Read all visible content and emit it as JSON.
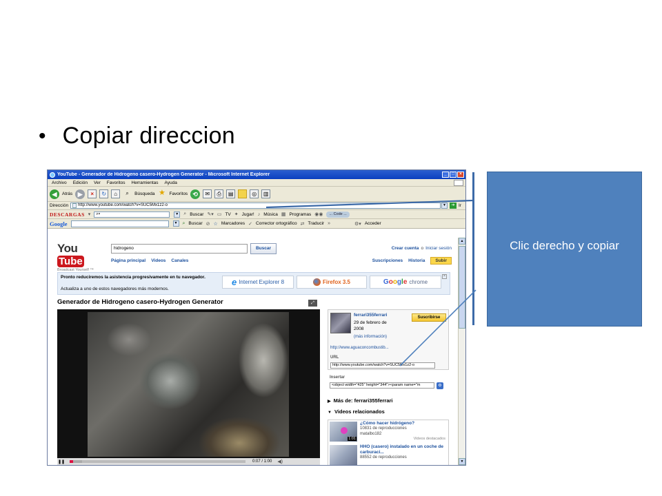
{
  "slide": {
    "bullet_text": "Copiar direccion",
    "callout_text": "Clic derecho y copiar",
    "callout_color": "#4f81bd"
  },
  "window": {
    "title": "YouTube - Generador de Hidrogeno casero-Hydrogen Generator - Microsoft Internet Explorer",
    "menu": [
      "Archivo",
      "Edición",
      "Ver",
      "Favoritos",
      "Herramientas",
      "Ayuda"
    ],
    "toolbar": {
      "back": "Atrás",
      "search": "Búsqueda",
      "favorites": "Favoritos"
    },
    "address_label": "Dirección",
    "address_value": "http://www.youtube.com/watch?v=SUC5Mx1z2-o",
    "go_label": "Ir",
    "descargas_label": "DESCARGAS",
    "descargas_items": {
      "buscar": "Buscar",
      "tv": "TV",
      "jugar": "Jugar!",
      "musica": "Música",
      "programas": "Programas",
      "code": "... Code ..."
    },
    "google_bar": {
      "logo": "Google",
      "buscar": "Buscar",
      "marcadores": "Marcadores",
      "corrector": "Corrector ortográfico",
      "traducir": "Traducir",
      "acceder": "Acceder"
    }
  },
  "youtube": {
    "logo_you": "You",
    "logo_tube": "Tube",
    "tagline": "Broadcast Yourself ™",
    "search_value": "hidrogeno",
    "search_button": "Buscar",
    "nav": [
      "Página principal",
      "Videos",
      "Canales"
    ],
    "create_account": "Crear cuenta",
    "or": "o",
    "login": "Iniciar sesión",
    "subscriptions": "Suscripciones",
    "history": "Historia",
    "upload": "Subir",
    "notice_line1": "Pronto reduciremos la asistencia progresivamente en tu navegador.",
    "notice_line2": "Actualiza a uno de estos navegadores más modernos.",
    "ie_label": "Internet Explorer 8",
    "firefox_label": "Firefox 3.5",
    "chrome_label": "chrome",
    "video_title": "Generador de Hidrogeno casero-Hydrogen Generator",
    "time": "0:07 / 1:00",
    "progress_played": 0.02,
    "progress_buffered": 0.07,
    "uploader": "ferrari355ferrari",
    "upload_date": "29 de febrero de 2008",
    "more_info": "(más información)",
    "subscribe": "Suscribirse",
    "link": "http://www.aguaconcombustib...",
    "url_label": "URL",
    "url_value": "http://www.youtube.com/watch?v=SUC5Mx1z2-o",
    "embed_label": "Insertar",
    "embed_value": "<object width=\"425\" height=\"344\"><param name=\"m",
    "more_from": "Más de: ferrari355ferrari",
    "related_heading": "Videos relacionados",
    "related": [
      {
        "title": "¿Cómo hacer hidrógeno?",
        "views": "10831 de reproducciones",
        "user": "matalbo182",
        "badge": "Videos destacados",
        "duration": "1:01"
      },
      {
        "title": "HHO (casero) instalado en un coche de carburaci...",
        "views": "88552 de reproducciones",
        "user": "",
        "badge": "",
        "duration": ""
      }
    ]
  }
}
